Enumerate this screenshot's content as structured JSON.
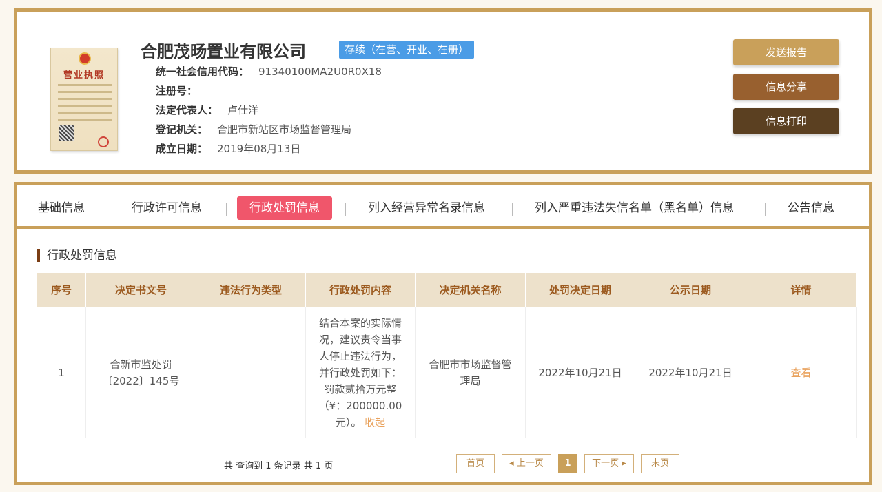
{
  "company": {
    "name": "合肥茂旸置业有限公司",
    "status": "存续（在营、开业、在册）",
    "fields": [
      {
        "label": "统一社会信用代码：",
        "value": "91340100MA2U0R0X18"
      },
      {
        "label": "注册号：",
        "value": ""
      },
      {
        "label": "法定代表人：",
        "value": "卢仕洋"
      },
      {
        "label": "登记机关：",
        "value": "合肥市新站区市场监督管理局"
      },
      {
        "label": "成立日期：",
        "value": "2019年08月13日"
      }
    ],
    "license_title": "营业执照"
  },
  "actions": {
    "send_report": "发送报告",
    "share": "信息分享",
    "print": "信息打印"
  },
  "colors": {
    "border": "#c9a05a",
    "btn_send": "#c9a05a",
    "btn_share": "#98602f",
    "btn_print": "#5b4021",
    "active_tab": "#f0566b",
    "status_badge": "#4b9ce6",
    "link": "#e9a25d"
  },
  "tabs": [
    {
      "label": "基础信息"
    },
    {
      "label": "行政许可信息"
    },
    {
      "label": "行政处罚信息"
    },
    {
      "label": "列入经营异常名录信息"
    },
    {
      "label": "列入严重违法失信名单（黑名单）信息"
    },
    {
      "label": "公告信息"
    }
  ],
  "section": {
    "title": "行政处罚信息"
  },
  "table": {
    "headers": [
      "序号",
      "决定书文号",
      "违法行为类型",
      "行政处罚内容",
      "决定机关名称",
      "处罚决定日期",
      "公示日期",
      "详情"
    ],
    "rows": [
      {
        "index": "1",
        "doc_no": "合新市监处罚〔2022〕145号",
        "violation_type": "",
        "content": "结合本案的实际情况，建议责令当事人停止违法行为，并行政处罚如下：罚款贰拾万元整（¥：200000.00元）。",
        "collapse": "收起",
        "authority": "合肥市市场监督管理局",
        "decision_date": "2022年10月21日",
        "publish_date": "2022年10月21日",
        "detail": "查看"
      }
    ]
  },
  "pagination": {
    "summary": "共 查询到 1 条记录 共 1 页",
    "first": "首页",
    "prev": "上一页",
    "current": "1",
    "next": "下一页",
    "last": "末页"
  }
}
